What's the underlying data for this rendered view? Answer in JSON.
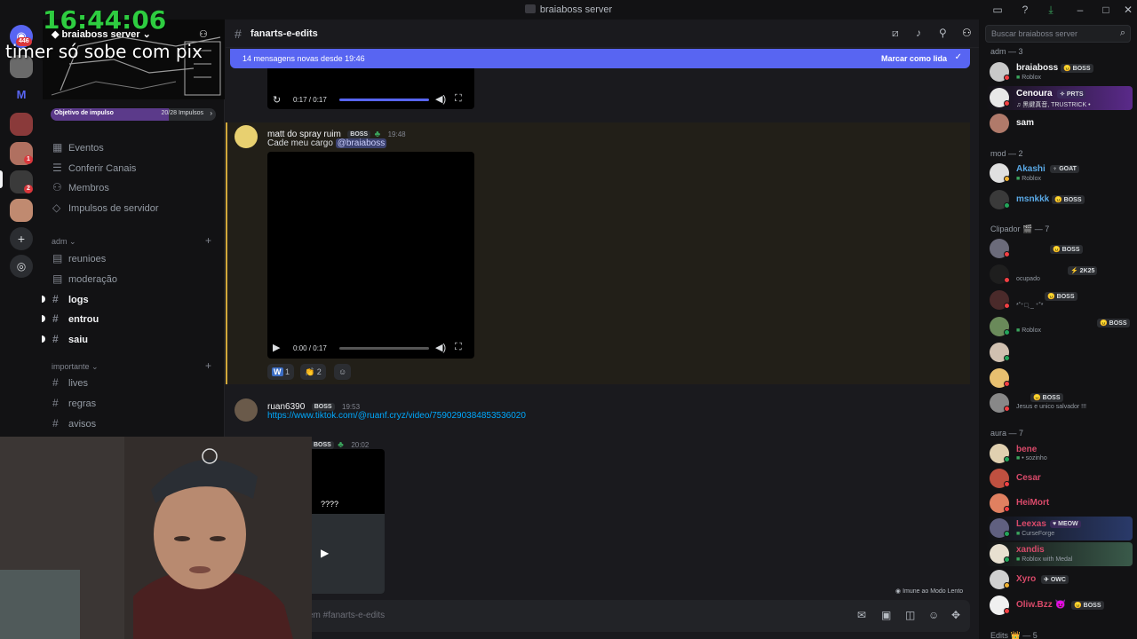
{
  "window": {
    "title": "braiaboss server"
  },
  "stream": {
    "timer": "16:44:06",
    "overlay_text": "timer só sobe com pix"
  },
  "rail": {
    "unread_badge": "446",
    "badges": [
      "1",
      "2"
    ]
  },
  "sidebar": {
    "server_name": "braiaboss server",
    "boost": {
      "label": "Objetivo de impulso",
      "progress": "20/28 Impulsos",
      "fraction": 0.714
    },
    "links": [
      "Eventos",
      "Conferir Canais",
      "Membros",
      "Impulsos de servidor"
    ],
    "categories": [
      {
        "name": "adm",
        "channels": [
          {
            "name": "reunioes",
            "unread": false
          },
          {
            "name": "moderação",
            "unread": false
          },
          {
            "name": "logs",
            "unread": true
          },
          {
            "name": "entrou",
            "unread": true
          },
          {
            "name": "saiu",
            "unread": true
          }
        ]
      },
      {
        "name": "importante",
        "channels": [
          {
            "name": "lives",
            "unread": false
          },
          {
            "name": "regras",
            "unread": false
          },
          {
            "name": "avisos",
            "unread": false
          }
        ]
      }
    ]
  },
  "chat": {
    "channel": "fanarts-e-edits",
    "new_messages": "14 mensagens novas desde 19:46",
    "mark_read": "Marcar como lida",
    "top_video_time": "0:17 / 0:17",
    "messages": [
      {
        "author": "matt do spray ruim",
        "tag": "BOSS",
        "time": "19:48",
        "text": "Cade meu cargo ",
        "mention": "@braiaboss",
        "video_time": "0:00 / 0:17",
        "reactions": [
          {
            "emoji": "W",
            "count": "1"
          },
          {
            "emoji": "👏",
            "count": "2"
          }
        ]
      },
      {
        "author": "ruan6390",
        "tag": "BOSS",
        "time": "19:53",
        "link": "https://www.tiktok.com/@ruanf.cryz/video/7590290384853536020"
      },
      {
        "author": "",
        "tag": "BOSS",
        "time": "20:02",
        "caption": "????"
      }
    ],
    "slowmode_note": "Imune ao Modo Lento",
    "input_placeholder": "em #fanarts-e-edits"
  },
  "members": {
    "search_placeholder": "Buscar braiaboss server",
    "groups": [
      {
        "title": "adm — 3",
        "items": [
          {
            "name": "braiaboss",
            "tag": "BOSS",
            "sub": "Roblox",
            "color": "#f2f3f5",
            "av": "#c9c9c9"
          },
          {
            "name": "Cenoura",
            "tag": "PRTS",
            "sub": "♫ 黑鍵真音, TRUSTRICK • ",
            "color": "#ffffff",
            "av": "#e8e8e8"
          },
          {
            "name": "sam",
            "tag": "",
            "sub": "",
            "color": "#f2f3f5",
            "av": "#b07a6a"
          }
        ]
      },
      {
        "title": "mod — 2",
        "items": [
          {
            "name": "Akashi",
            "tag": "GOAT",
            "sub": "Roblox",
            "color": "#5aa9e6",
            "av": "#e0e0e0"
          },
          {
            "name": "msnkkk",
            "tag": "BOSS",
            "sub": "",
            "color": "#5aa9e6",
            "av": "#3a3a3a"
          }
        ]
      },
      {
        "title": "Clipador 🎬 — 7",
        "items": [
          {
            "name": "",
            "tag": "BOSS",
            "sub": "",
            "color": "#f2f3f5",
            "av": "#6b6b7a"
          },
          {
            "name": "",
            "tag": "2K25",
            "sub": "ocupado",
            "color": "#f2f3f5",
            "av": "#1e1e1e"
          },
          {
            "name": "",
            "tag": "BOSS",
            "sub": "*˚⁺‧͙ _ ⁺˚*",
            "color": "#f2f3f5",
            "av": "#4a2a2a"
          },
          {
            "name": "",
            "tag": "BOSS",
            "sub": "Roblox",
            "color": "#f2f3f5",
            "av": "#6a8a5a"
          },
          {
            "name": "",
            "tag": "",
            "sub": "",
            "color": "#f2f3f5",
            "av": "#d0c0b0"
          },
          {
            "name": "",
            "tag": "",
            "sub": "",
            "color": "#f2f3f5",
            "av": "#e8c070"
          },
          {
            "name": "",
            "tag": "BOSS",
            "sub": "Jesus e unico salvador !!!",
            "color": "#f2f3f5",
            "av": "#888"
          }
        ]
      },
      {
        "title": "aura — 7",
        "items": [
          {
            "name": "bene",
            "tag": "",
            "sub": "• sozinho",
            "color": "#d94a6a",
            "av": "#e0d0b0"
          },
          {
            "name": "Cesar",
            "tag": "",
            "sub": "",
            "color": "#d94a6a",
            "av": "#c05040"
          },
          {
            "name": "HeiMort",
            "tag": "",
            "sub": "",
            "color": "#d94a6a",
            "av": "#e08060"
          },
          {
            "name": "Leexas",
            "tag": "MEOW",
            "sub": "CurseForge",
            "color": "#d94a6a",
            "av": "#606080"
          },
          {
            "name": "xandis",
            "tag": "",
            "sub": "Roblox with Medal",
            "color": "#d94a6a",
            "av": "#e8e0d0"
          },
          {
            "name": "Xyro",
            "tag": "OWC",
            "sub": "",
            "color": "#d94a6a",
            "av": "#d0d0d0"
          },
          {
            "name": "Oliw.Bzz 😈",
            "tag": "BOSS",
            "sub": "",
            "color": "#d94a6a",
            "av": "#f0f0f0"
          }
        ]
      },
      {
        "title": "Edits 👑 — 5",
        "items": []
      }
    ]
  }
}
